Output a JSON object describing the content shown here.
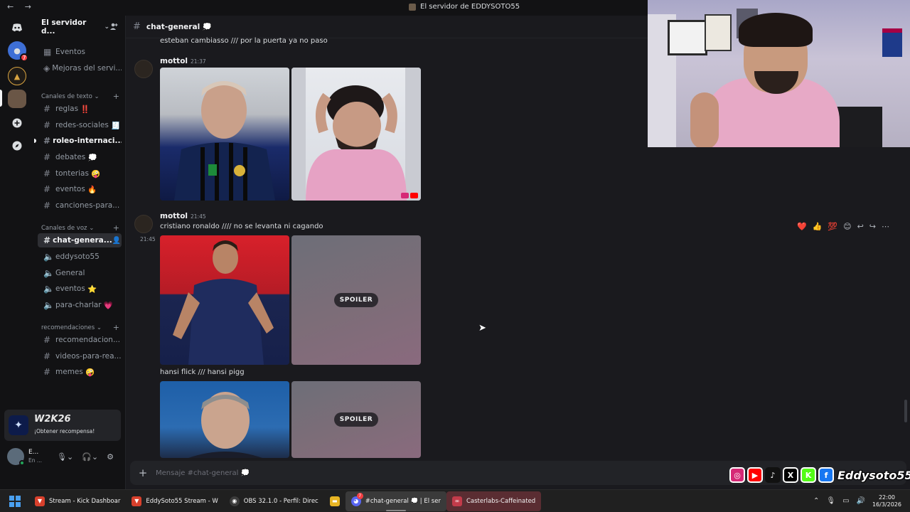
{
  "window": {
    "title": "El servidor de EDDYSOTO55",
    "nav_arrows": "← →"
  },
  "server": {
    "name": "El servidor d...",
    "chevron": "⌄"
  },
  "sidebar": {
    "top_items": [
      {
        "icon": "calendar-icon",
        "label": "Eventos"
      },
      {
        "icon": "boost-icon",
        "label": "Mejoras del servi..."
      }
    ],
    "categories": [
      {
        "label": "Canales de texto",
        "toggle": "⌄"
      },
      {
        "label": "Canales de voz",
        "toggle": "⌄"
      },
      {
        "label": "recomendaciones",
        "toggle": "⌄"
      }
    ],
    "text_channels": [
      {
        "label": "reglas",
        "emoji": "‼️"
      },
      {
        "label": "redes-sociales",
        "emoji": "🧾"
      },
      {
        "label": "roleo-internaci...",
        "emoji": ""
      },
      {
        "label": "debates",
        "emoji": "💭"
      },
      {
        "label": "tonterias",
        "emoji": "🤪"
      },
      {
        "label": "eventos",
        "emoji": "🔥"
      },
      {
        "label": "canciones-para...",
        "emoji": ""
      }
    ],
    "voice_channels": [
      {
        "label": "chat-genera...",
        "emoji": ""
      },
      {
        "label": "eddysoto55",
        "emoji": ""
      },
      {
        "label": "General",
        "emoji": ""
      },
      {
        "label": "eventos",
        "emoji": "⭐"
      },
      {
        "label": "para-charlar",
        "emoji": "💗"
      }
    ],
    "reco_channels": [
      {
        "label": "recomendacion...",
        "emoji": ""
      },
      {
        "label": "videos-para-rea...",
        "emoji": ""
      },
      {
        "label": "memes",
        "emoji": "🤪"
      }
    ]
  },
  "promo": {
    "logo": "W2K26",
    "text": "¡Obtener recompensa!"
  },
  "user": {
    "name": "E...",
    "status": "En ..."
  },
  "channel": {
    "name": "chat-general",
    "emoji": "💭"
  },
  "messages": {
    "prev_text": "esteban cambiasso /// por la puerta ya no paso",
    "m1": {
      "author": "mottol",
      "time": "21:37"
    },
    "m2": {
      "author": "mottol",
      "time": "21:45",
      "text": "cristiano ronaldo //// no se levanta ni cagando",
      "side_time": "21:45"
    },
    "m3": {
      "text": "hansi flick /// hansi pigg"
    },
    "spoiler_label": "SPOILER"
  },
  "reactions": [
    "❤️",
    "👍",
    "💯",
    "😊",
    "↩",
    "↪",
    "⋯"
  ],
  "composer": {
    "placeholder": "Mensaje #chat-general 💭",
    "plus": "+"
  },
  "overlay": {
    "handle": "Eddysoto55"
  },
  "taskbar": {
    "items": [
      {
        "label": "Stream - Kick Dashboar",
        "color": "#d8402c"
      },
      {
        "label": "EddySoto55 Stream - W",
        "color": "#d8402c"
      },
      {
        "label": "OBS 32.1.0 - Perfil: Direc",
        "color": "#3b3b3b"
      },
      {
        "label": "",
        "color": "#e8b524"
      },
      {
        "label": "#chat-general 💭 | El ser",
        "color": "#5865f2"
      },
      {
        "label": "Casterlabs-Caffeinated",
        "color": "#c23b4a"
      }
    ],
    "time": "22:00",
    "date": "16/3/2026"
  },
  "colors": {
    "accent": "#5865f2",
    "online": "#23a55a",
    "danger": "#f23f43"
  }
}
